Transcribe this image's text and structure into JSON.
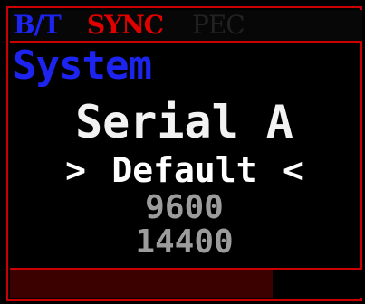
{
  "status_bar": {
    "bt": {
      "label": "B/T",
      "color": "#1d24f0"
    },
    "sync": {
      "label": "SYNC",
      "color": "#e00000"
    },
    "pec": {
      "label": "PEC",
      "color": "#222222"
    }
  },
  "menu": {
    "title": "System",
    "subtitle": "Serial A",
    "options": [
      {
        "label": "Default",
        "selected": true,
        "marker_left": ">",
        "marker_right": "<"
      },
      {
        "label": "9600",
        "selected": false
      },
      {
        "label": "14400",
        "selected": false
      }
    ]
  },
  "progress": {
    "fraction": 0.745,
    "color": "#3b0000"
  },
  "colors": {
    "frame": "#cc0000",
    "background": "#000000",
    "selected_text": "#ffffff",
    "unselected_text": "#9c9c9c"
  }
}
